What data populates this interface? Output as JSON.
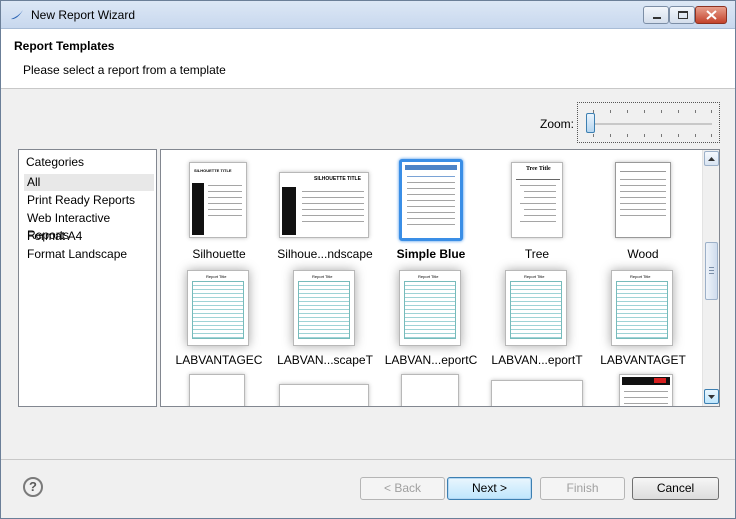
{
  "window": {
    "title": "New Report Wizard"
  },
  "header": {
    "title": "Report Templates",
    "description": "Please select a report from a template"
  },
  "zoom": {
    "label": "Zoom:",
    "value": 0
  },
  "categories": {
    "header": "Categories",
    "items": [
      {
        "label": "All",
        "selected": true
      },
      {
        "label": "Print Ready Reports"
      },
      {
        "label": "Web Interactive Reports"
      },
      {
        "label": "Format A4"
      },
      {
        "label": "Format Landscape"
      }
    ]
  },
  "templates": [
    {
      "label": "Silhouette",
      "thumb_title": "SILHOUETTE TITLE"
    },
    {
      "label": "Silhoue...ndscape",
      "thumb_title": "SILHOUETTE TITLE"
    },
    {
      "label": "Simple Blue",
      "selected": true
    },
    {
      "label": "Tree",
      "thumb_title": "Tree Title"
    },
    {
      "label": "Wood"
    },
    {
      "label": "LABVANTAGEC",
      "thumb_title": "Report Title"
    },
    {
      "label": "LABVAN...scapeT",
      "thumb_title": "Report Title"
    },
    {
      "label": "LABVAN...eportC",
      "thumb_title": "Report Title"
    },
    {
      "label": "LABVAN...eportT",
      "thumb_title": "Report Title"
    },
    {
      "label": "LABVANTAGET",
      "thumb_title": "Report Title"
    }
  ],
  "buttons": {
    "back": "< Back",
    "next": "Next >",
    "finish": "Finish",
    "cancel": "Cancel",
    "help": "?"
  },
  "colors": {
    "selection": "#3a8ee6",
    "titlebar": "#dce7f5",
    "close": "#c3422b"
  }
}
